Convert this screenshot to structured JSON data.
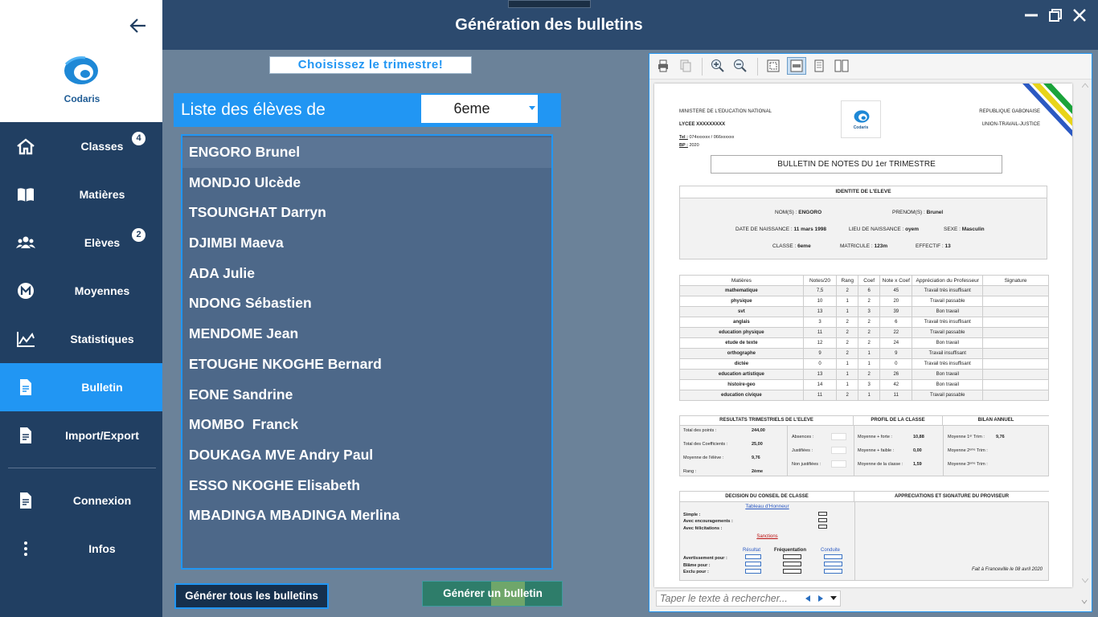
{
  "window": {
    "title": "Génération des bulletins"
  },
  "sidebar": {
    "brand": "Codaris",
    "items": [
      {
        "label": "Classes",
        "badge": "4"
      },
      {
        "label": "Matières"
      },
      {
        "label": "Elèves",
        "badge": "2"
      },
      {
        "label": "Moyennes"
      },
      {
        "label": "Statistiques"
      },
      {
        "label": "Bulletin"
      },
      {
        "label": "Import/Export"
      },
      {
        "label": "Connexion"
      },
      {
        "label": "Infos"
      }
    ]
  },
  "main": {
    "trimester_button": "Choisissez le trimestre!",
    "list_title": "Liste des élèves de",
    "class_select": "6eme",
    "students": [
      "ENGORO Brunel",
      "MONDJO Ulcède",
      "TSOUNGHAT Darryn",
      "DJIMBI Maeva",
      "ADA Julie",
      "NDONG Sébastien",
      "MENDOME Jean",
      "ETOUGHE NKOGHE Bernard",
      "EONE Sandrine",
      "MOMBO  Franck",
      "DOUKAGA MVE Andry Paul",
      "ESSO NKOGHE Elisabeth",
      "MBADINGA MBADINGA Merlina"
    ],
    "generate_all": "Générer tous les bulletins",
    "generate_one": "Générer un bulletin"
  },
  "viewer": {
    "search_placeholder": "Taper le texte à rechercher...",
    "report": {
      "ministry": "MINISTERE DE L'EDUCATION NATIONAL",
      "school": "LYCEE XXXXXXXXX",
      "tel_label": "Tel :",
      "tel": "074xxxxxx / 066xxxxxx",
      "bp_label": "BP :",
      "bp": "2020",
      "logo": "Codaris",
      "republic": "REPUBLIQUE GABONAISE",
      "motto": "UNION-TRAVAIL-JUSTICE",
      "title": "BULLETIN DE NOTES DU 1er TRIMESTRE",
      "identity_title": "IDENTITE DE L'ELEVE",
      "nom_label": "NOM(S) :",
      "nom": "ENGORO",
      "prenom_label": "PRENOM(S) :",
      "prenom": "Brunel",
      "dob_label": "DATE DE NAISSANCE :",
      "dob": "11 mars 1998",
      "pob_label": "LIEU DE NAISSANCE :",
      "pob": "oyem",
      "sexe_label": "SEXE :",
      "sexe": "Masculin",
      "classe_label": "CLASSE :",
      "classe": "6eme",
      "matricule_label": "MATRICULE :",
      "matricule": "123m",
      "effectif_label": "EFFECTIF :",
      "effectif": "13",
      "grades_headers": [
        "Matières",
        "Notes/20",
        "Rang",
        "Coef",
        "Note x Coef",
        "Appréciation du Professeur",
        "Signature"
      ],
      "grades": [
        [
          "mathematique",
          "7,5",
          "2",
          "6",
          "45",
          "Travail très insuffisant"
        ],
        [
          "physique",
          "10",
          "1",
          "2",
          "20",
          "Travail passable"
        ],
        [
          "svt",
          "13",
          "1",
          "3",
          "39",
          "Bon travail"
        ],
        [
          "anglais",
          "3",
          "2",
          "2",
          "6",
          "Travail très insuffisant"
        ],
        [
          "education physique",
          "11",
          "2",
          "2",
          "22",
          "Travail passable"
        ],
        [
          "etude de texte",
          "12",
          "2",
          "2",
          "24",
          "Bon travail"
        ],
        [
          "orthographe",
          "9",
          "2",
          "1",
          "9",
          "Travail insuffisant"
        ],
        [
          "dictée",
          "0",
          "1",
          "1",
          "0",
          "Travail très insuffisant"
        ],
        [
          "education artistique",
          "13",
          "1",
          "2",
          "26",
          "Bon travail"
        ],
        [
          "histoire-geo",
          "14",
          "1",
          "3",
          "42",
          "Bon travail"
        ],
        [
          "education civique",
          "11",
          "2",
          "1",
          "11",
          "Travail passable"
        ]
      ],
      "results_title": "RESULTATS TRIMESTRIELS DE L'ELEVE",
      "total_points_label": "Total des points :",
      "total_points": "244,00",
      "total_coef_label": "Total des Coefficients :",
      "total_coef": "25,00",
      "moyenne_label": "Moyenne de l'élève :",
      "moyenne": "9,76",
      "rang_label": "Rang :",
      "rang": "2ème",
      "absences_label": "Absences :",
      "justifiees_label": "Justifiées :",
      "non_justifiees_label": "Non justifiées :",
      "profile_title": "PROFIL DE LA CLASSE",
      "moy_forte_label": "Moyenne + forte :",
      "moy_forte": "10,88",
      "moy_faible_label": "Moyenne + faible :",
      "moy_faible": "0,00",
      "moy_classe_label": "Moyenne de la classe :",
      "moy_classe": "1,59",
      "annual_title": "BILAN ANNUEL",
      "t1_label": "Moyenne 1ᵉʳ Trim :",
      "t1": "9,76",
      "t2_label": "Moyenne 2ᵉᵐᵉ Trim :",
      "t3_label": "Moyenne 3ᵉᵐᵉ Trim :",
      "council_title": "DECISION DU CONSEIL DE CLASSE",
      "honor_title": "Tableau d'Honneur",
      "simple_label": "Simple :",
      "encouragements_label": "Avec encouragements :",
      "felicitations_label": "Avec félicitations :",
      "sanctions_title": "Sanctions",
      "resultat_label": "Résultat",
      "frequentation_label": "Fréquentation",
      "conduite_label": "Conduite",
      "avertissement_label": "Avertissement pour :",
      "blame_label": "Blâme pour :",
      "exclu_label": "Exclu pour :",
      "principal_title": "APPRECIATIONS ET SIGNATURE DU PROVISEUR",
      "fait_a": "Fait à Franceville le 08 avril 2020"
    }
  },
  "colors": {
    "sidebar": "#213f62",
    "header": "#2c4a6e",
    "active": "#2196f3",
    "content": "#6b8299",
    "list": "#4d6889",
    "accent_green": "#2e7d6a"
  }
}
